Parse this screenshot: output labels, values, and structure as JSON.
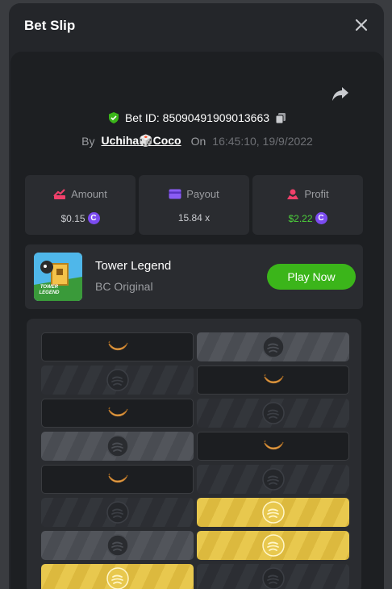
{
  "modal": {
    "title": "Bet Slip"
  },
  "bet": {
    "id_label": "Bet ID: 85090491909013663",
    "by_label": "By",
    "user": "Uchiha🎲Coco",
    "on_label": "On",
    "time": "16:45:10, 19/9/2022"
  },
  "stats": {
    "amount": {
      "label": "Amount",
      "value": "$0.15"
    },
    "payout": {
      "label": "Payout",
      "value": "15.84 x"
    },
    "profit": {
      "label": "Profit",
      "value": "$2.22"
    }
  },
  "game": {
    "name": "Tower Legend",
    "provider": "BC Original",
    "play_label": "Play Now",
    "thumb_text": "TOWER LEGEND"
  },
  "grid_rows": [
    [
      "banana-dark",
      "coin-gray"
    ],
    [
      "coin-stripe",
      "banana-dark"
    ],
    [
      "banana-dark",
      "coin-stripe"
    ],
    [
      "coin-gray",
      "banana-dark"
    ],
    [
      "banana-dark",
      "coin-stripe"
    ],
    [
      "coin-stripe",
      "coin-gold"
    ],
    [
      "coin-gray",
      "coin-gold"
    ],
    [
      "coin-gold",
      "coin-stripe"
    ]
  ],
  "colors": {
    "accent_green": "#3bb51a",
    "profit_green": "#4cd13b",
    "coin_purple": "#7b4bf0",
    "gold": "#e8c84e"
  }
}
